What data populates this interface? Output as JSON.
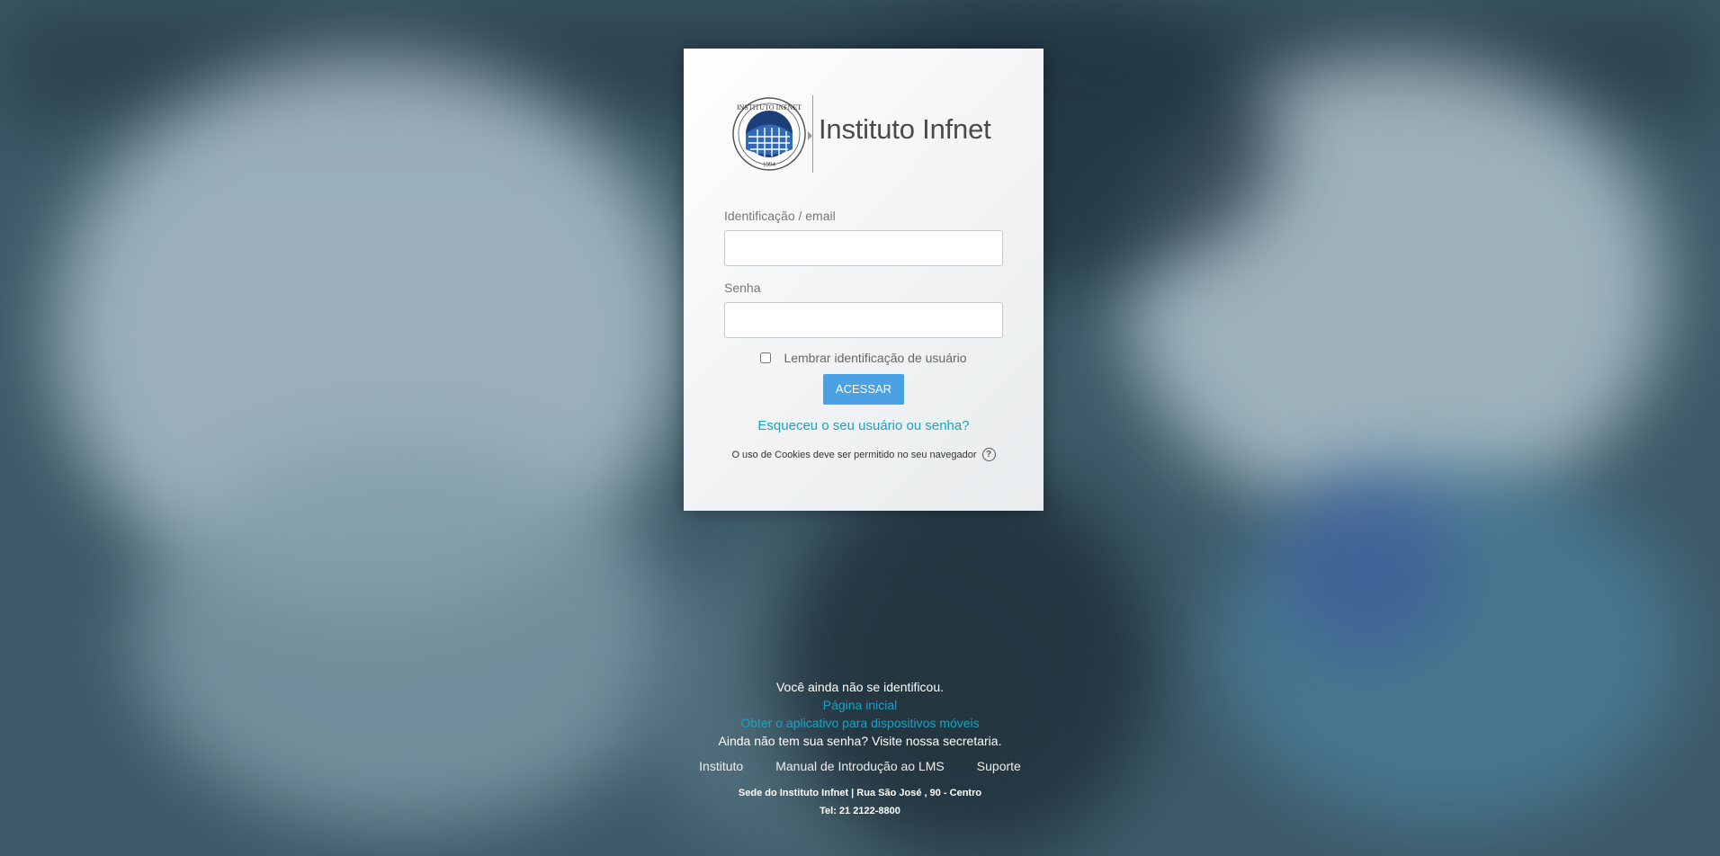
{
  "logo": {
    "seal_text": "INSTITUTO INFNET",
    "seal_year": "1994",
    "name": "Instituto Infnet"
  },
  "login": {
    "username_label": "Identificação / email",
    "username_value": "",
    "password_label": "Senha",
    "password_value": "",
    "remember_label": "Lembrar identificação de usuário",
    "remember_checked": false,
    "submit_label": "ACESSAR",
    "forgot_link": "Esqueceu o seu usuário ou senha?",
    "cookies_notice": "O uso de Cookies deve ser permitido no seu navegador",
    "help_icon": "question-circle-icon"
  },
  "footer": {
    "not_logged": "Você ainda não se identificou.",
    "home_link": "Página inicial",
    "app_link": "Obter o aplicativo para dispositivos móveis",
    "no_password": "Ainda não tem sua senha? Visite nossa secretaria.",
    "nav": [
      "Instituto",
      "Manual de Introdução ao LMS",
      "Suporte"
    ],
    "address": "Sede do Instituto Infnet | Rua São José , 90 - Centro",
    "phone": "Tel: 21 2122-8800"
  },
  "colors": {
    "accent": "#4aa1e4",
    "link": "#1ba2c4"
  }
}
